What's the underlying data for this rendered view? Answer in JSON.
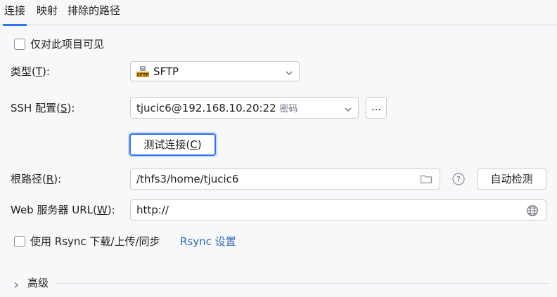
{
  "tabs": [
    {
      "label": "连接",
      "active": true
    },
    {
      "label": "映射",
      "active": false
    },
    {
      "label": "排除的路径",
      "active": false
    }
  ],
  "visible_only_project": {
    "label": "仅对此项目可见",
    "checked": false
  },
  "type": {
    "label_prefix": "类型(",
    "label_mnemonic": "T",
    "label_suffix": "):",
    "value": "SFTP",
    "icon": "sftp-icon"
  },
  "ssh": {
    "label_prefix": "SSH 配置(",
    "label_mnemonic": "S",
    "label_suffix": "):",
    "value": "tjucic6@192.168.10.20:22",
    "value_hint": "密码",
    "more_button": "..."
  },
  "test_connection": {
    "label_prefix": "测试连接(",
    "label_mnemonic": "C",
    "label_suffix": ")"
  },
  "root_path": {
    "label_prefix": "根路径(",
    "label_mnemonic": "R",
    "label_suffix": "):",
    "value": "/thfs3/home/tjucic6",
    "autodetect": "自动检测"
  },
  "web_url": {
    "label_prefix": "Web 服务器 URL(",
    "label_mnemonic": "W",
    "label_suffix": "):",
    "value": "http://"
  },
  "rsync": {
    "label": "使用 Rsync 下载/上传/同步",
    "checked": false,
    "settings_link": "Rsync 设置"
  },
  "advanced": {
    "label": "高级"
  },
  "colors": {
    "accent": "#3574f0",
    "link": "#2e6bb8",
    "background": "#f7f8fa"
  }
}
